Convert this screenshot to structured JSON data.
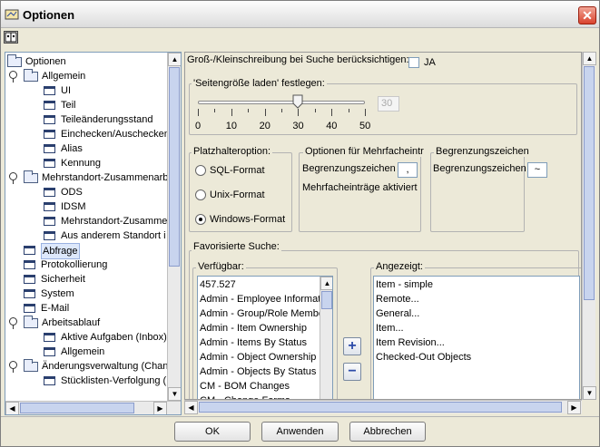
{
  "window": {
    "title": "Optionen",
    "close_glyph": "✕"
  },
  "tree": {
    "items": [
      {
        "label": "Optionen",
        "level": 0,
        "type": "folder",
        "expand": false
      },
      {
        "label": "Allgemein",
        "level": 1,
        "type": "folder",
        "expand": true
      },
      {
        "label": "UI",
        "level": 2,
        "type": "leaf"
      },
      {
        "label": "Teil",
        "level": 2,
        "type": "leaf"
      },
      {
        "label": "Teileänderungsstand",
        "level": 2,
        "type": "leaf"
      },
      {
        "label": "Einchecken/Auschecken",
        "level": 2,
        "type": "leaf"
      },
      {
        "label": "Alias",
        "level": 2,
        "type": "leaf"
      },
      {
        "label": "Kennung",
        "level": 2,
        "type": "leaf"
      },
      {
        "label": "Mehrstandort-Zusammenarb",
        "level": 1,
        "type": "folder",
        "expand": true
      },
      {
        "label": "ODS",
        "level": 2,
        "type": "leaf"
      },
      {
        "label": "IDSM",
        "level": 2,
        "type": "leaf"
      },
      {
        "label": "Mehrstandort-Zusammen",
        "level": 2,
        "type": "leaf"
      },
      {
        "label": "Aus anderem Standort i",
        "level": 2,
        "type": "leaf"
      },
      {
        "label": "Abfrage",
        "level": 1,
        "type": "leaf",
        "selected": true
      },
      {
        "label": "Protokollierung",
        "level": 1,
        "type": "leaf"
      },
      {
        "label": "Sicherheit",
        "level": 1,
        "type": "leaf"
      },
      {
        "label": "System",
        "level": 1,
        "type": "leaf"
      },
      {
        "label": "E-Mail",
        "level": 1,
        "type": "leaf"
      },
      {
        "label": "Arbeitsablauf",
        "level": 1,
        "type": "folder",
        "expand": true
      },
      {
        "label": "Aktive Aufgaben (Inbox)",
        "level": 2,
        "type": "leaf"
      },
      {
        "label": "Allgemein",
        "level": 2,
        "type": "leaf"
      },
      {
        "label": "Änderungsverwaltung (Chan",
        "level": 1,
        "type": "folder",
        "expand": true
      },
      {
        "label": "Stücklisten-Verfolgung (E",
        "level": 2,
        "type": "leaf"
      }
    ]
  },
  "case_option": {
    "label": "Groß-/Kleinschreibung bei Suche berücksichtigen:",
    "checkbox_label": "JA",
    "checked": false
  },
  "page_size": {
    "group_label": "'Seitengröße laden' festlegen:",
    "value": "30",
    "slider_value": 30,
    "ticks": [
      "0",
      "10",
      "20",
      "30",
      "40",
      "50"
    ]
  },
  "placeholder": {
    "group_label": "Platzhalteroption:",
    "options": [
      "SQL-Format",
      "Unix-Format",
      "Windows-Format"
    ],
    "selected": "Windows-Format"
  },
  "multi_entries": {
    "group_label": "Optionen für Mehrfacheintr",
    "delimiter_label": "Begrenzungszeichen",
    "delimiter_value": ",",
    "activated_label": "Mehrfacheinträge aktiviert"
  },
  "delimiter": {
    "group_label": "Begrenzungszeichen",
    "label": "Begrenzungszeichen",
    "value": "~"
  },
  "favorites": {
    "group_label": "Favorisierte Suche:",
    "available_label": "Verfügbar:",
    "available": [
      "457.527",
      "Admin - Employee Informati",
      "Admin - Group/Role Member",
      "Admin - Item Ownership",
      "Admin - Items By Status",
      "Admin - Object Ownership",
      "Admin - Objects By Status",
      "CM - BOM Changes",
      "CM - Change Forms"
    ],
    "shown_label": "Angezeigt:",
    "shown": [
      "Item - simple",
      "Remote...",
      "General...",
      "Item...",
      "Item Revision...",
      "Checked-Out Objects"
    ],
    "add_glyph": "+",
    "remove_glyph": "−"
  },
  "buttons": {
    "ok": {
      "label": "OK"
    },
    "apply": {
      "label": "Anwenden"
    },
    "cancel": {
      "label": "Abbrechen"
    }
  }
}
